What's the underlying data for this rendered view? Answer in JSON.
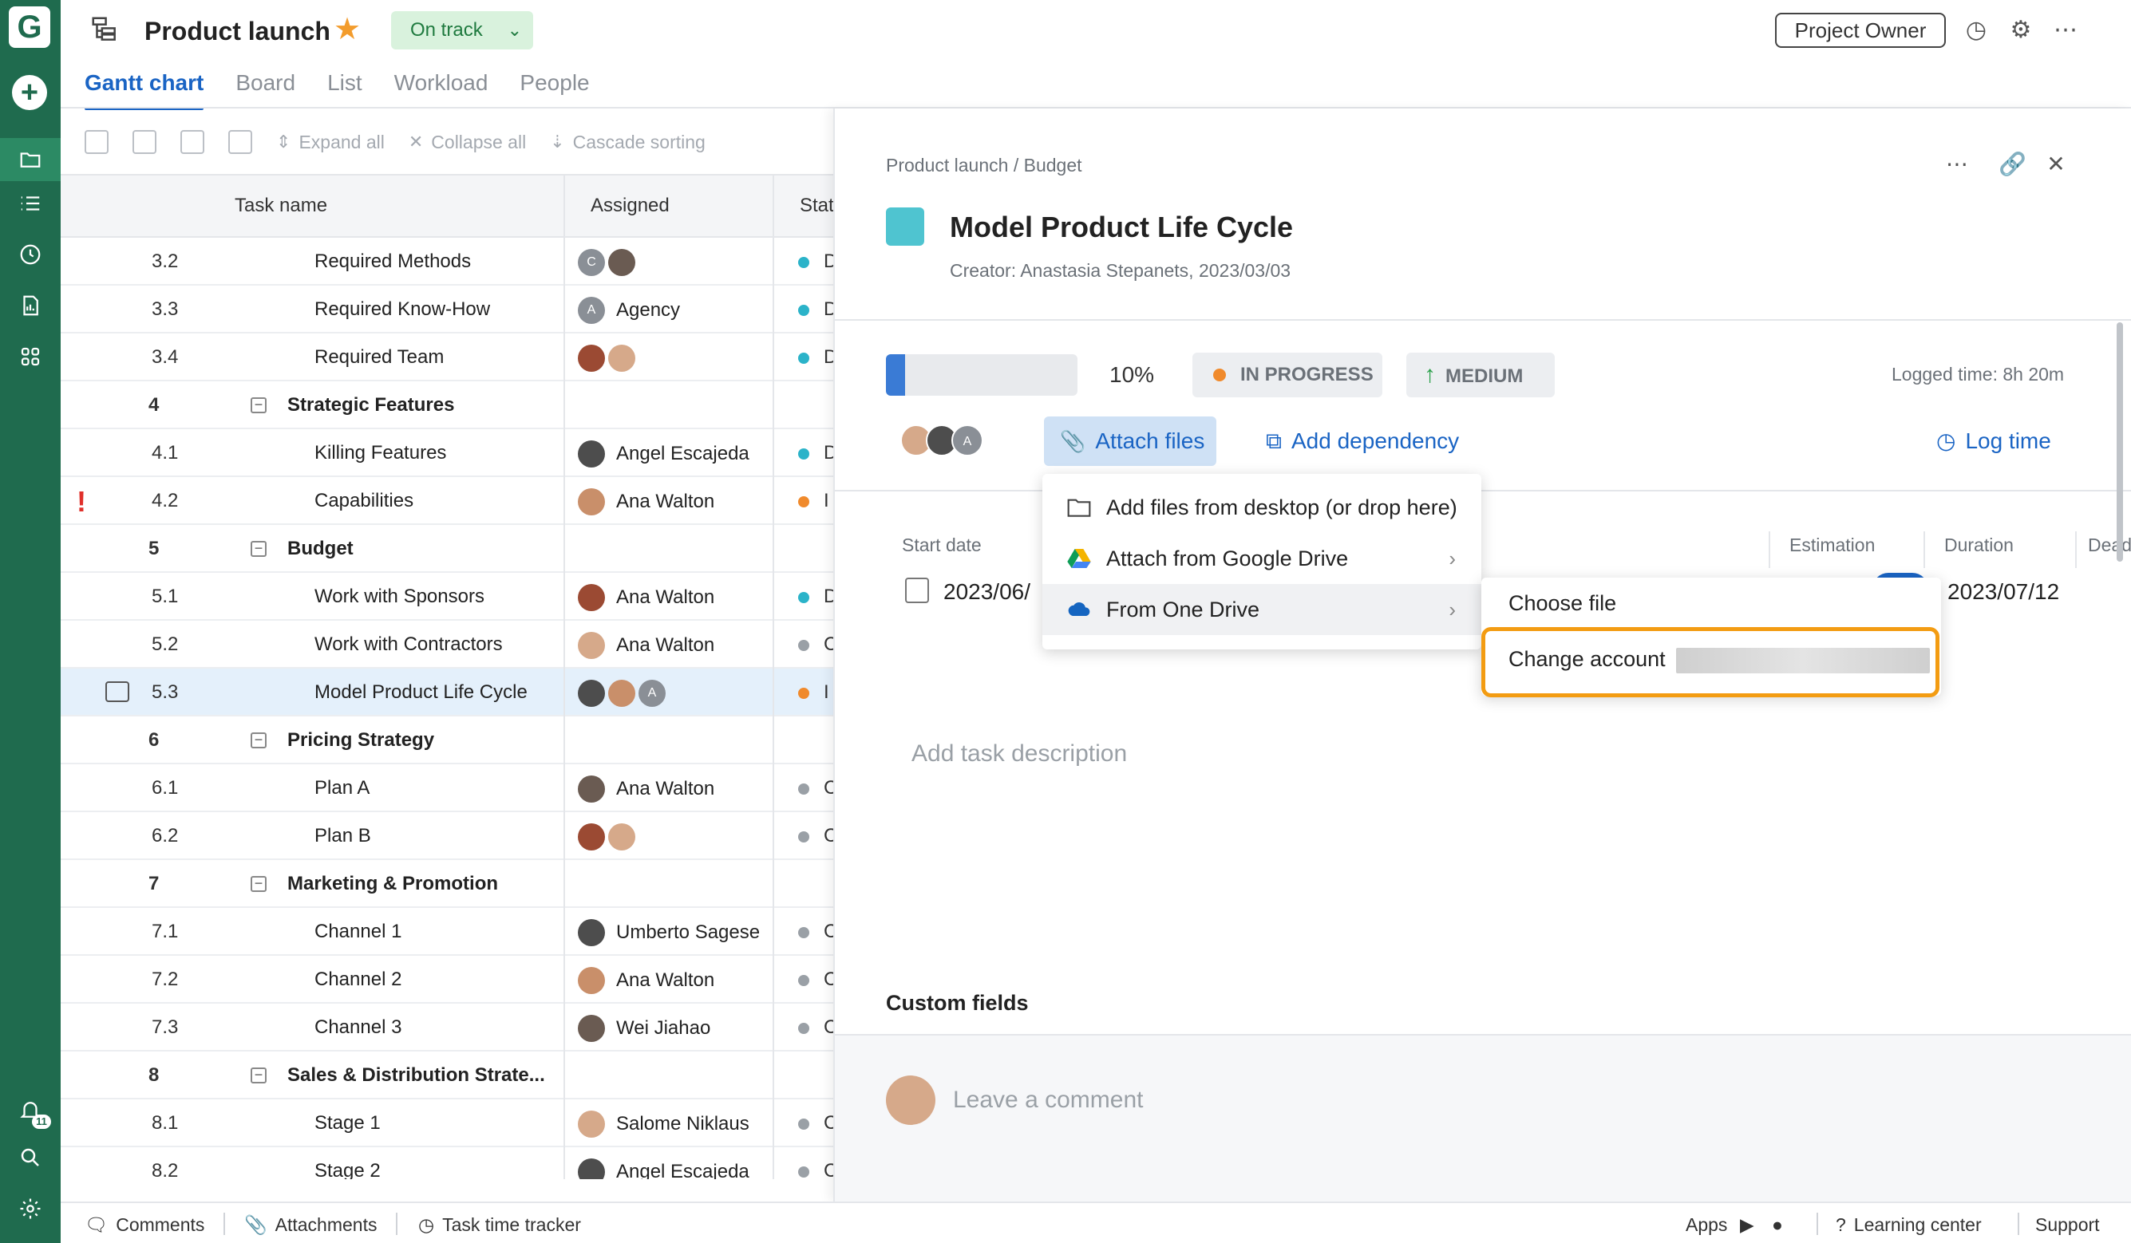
{
  "header": {
    "project_title": "Product launch",
    "status": "On track",
    "role_button": "Project Owner",
    "tabs": [
      "Gantt chart",
      "Board",
      "List",
      "Workload",
      "People"
    ],
    "active_tab": "Gantt chart"
  },
  "toolbar": {
    "expand_all": "Expand all",
    "collapse_all": "Collapse all",
    "cascade_sorting": "Cascade sorting"
  },
  "table": {
    "columns": {
      "task_name": "Task name",
      "assigned": "Assigned",
      "status": "Stat"
    },
    "rows": [
      {
        "num": "3.2",
        "name": "Required Methods",
        "group": false,
        "avatars": [
          "C",
          ""
        ],
        "assignee": "",
        "status_color": "#2bb3c9",
        "status_letter": "D"
      },
      {
        "num": "3.3",
        "name": "Required Know-How",
        "group": false,
        "avatars": [
          "A"
        ],
        "assignee": "Agency",
        "status_color": "#2bb3c9",
        "status_letter": "D"
      },
      {
        "num": "3.4",
        "name": "Required Team",
        "group": false,
        "avatars": [
          "",
          ""
        ],
        "assignee": "",
        "status_color": "#2bb3c9",
        "status_letter": "D"
      },
      {
        "num": "4",
        "name": "Strategic Features",
        "group": true
      },
      {
        "num": "4.1",
        "name": "Killing Features",
        "group": false,
        "avatars": [
          ""
        ],
        "assignee": "Angel Escajeda",
        "status_color": "#2bb3c9",
        "status_letter": "D"
      },
      {
        "num": "4.2",
        "name": "Capabilities",
        "group": false,
        "avatars": [
          ""
        ],
        "assignee": "Ana Walton",
        "status_color": "#f08a2c",
        "status_letter": "I",
        "flag": "!"
      },
      {
        "num": "5",
        "name": "Budget",
        "group": true
      },
      {
        "num": "5.1",
        "name": "Work with Sponsors",
        "group": false,
        "avatars": [
          ""
        ],
        "assignee": "Ana Walton",
        "status_color": "#2bb3c9",
        "status_letter": "D"
      },
      {
        "num": "5.2",
        "name": "Work with Contractors",
        "group": false,
        "avatars": [
          ""
        ],
        "assignee": "Ana Walton",
        "status_color": "#9aa0a6",
        "status_letter": "C"
      },
      {
        "num": "5.3",
        "name": "Model Product Life Cycle",
        "group": false,
        "avatars": [
          "",
          "",
          "A"
        ],
        "assignee": "",
        "status_color": "#f08a2c",
        "status_letter": "I",
        "selected": true
      },
      {
        "num": "6",
        "name": "Pricing Strategy",
        "group": true
      },
      {
        "num": "6.1",
        "name": "Plan A",
        "group": false,
        "avatars": [
          ""
        ],
        "assignee": "Ana Walton",
        "status_color": "#9aa0a6",
        "status_letter": "C"
      },
      {
        "num": "6.2",
        "name": "Plan B",
        "group": false,
        "avatars": [
          "",
          ""
        ],
        "assignee": "",
        "status_color": "#9aa0a6",
        "status_letter": "C"
      },
      {
        "num": "7",
        "name": "Marketing & Promotion",
        "group": true
      },
      {
        "num": "7.1",
        "name": "Channel 1",
        "group": false,
        "avatars": [
          ""
        ],
        "assignee": "Umberto Sagese",
        "status_color": "#9aa0a6",
        "status_letter": "C"
      },
      {
        "num": "7.2",
        "name": "Channel 2",
        "group": false,
        "avatars": [
          ""
        ],
        "assignee": "Ana Walton",
        "status_color": "#9aa0a6",
        "status_letter": "C"
      },
      {
        "num": "7.3",
        "name": "Channel 3",
        "group": false,
        "avatars": [
          ""
        ],
        "assignee": "Wei Jiahao",
        "status_color": "#9aa0a6",
        "status_letter": "C"
      },
      {
        "num": "8",
        "name": "Sales & Distribution Strate...",
        "group": true
      },
      {
        "num": "8.1",
        "name": "Stage 1",
        "group": false,
        "avatars": [
          ""
        ],
        "assignee": "Salome Niklaus",
        "status_color": "#9aa0a6",
        "status_letter": "C"
      },
      {
        "num": "8.2",
        "name": "Stage 2",
        "group": false,
        "avatars": [
          ""
        ],
        "assignee": "Angel Escajeda",
        "status_color": "#9aa0a6",
        "status_letter": "C"
      }
    ]
  },
  "panel": {
    "breadcrumb": "Product launch / Budget",
    "task_title": "Model Product Life Cycle",
    "creator": "Creator: Anastasia Stepanets, 2023/03/03",
    "progress_pct": "10%",
    "progress_value": 0.1,
    "status": "IN PROGRESS",
    "priority": "MEDIUM",
    "logged_time": "Logged time: 8h 20m",
    "attach_files": "Attach files",
    "add_dependency": "Add dependency",
    "log_time": "Log time",
    "labels": {
      "start_date": "Start date",
      "estimation": "Estimation",
      "duration": "Duration",
      "deadline": "Deadline"
    },
    "start_date_value": "2023/06/",
    "deadline_value": "2023/07/12",
    "description_placeholder": "Add task description",
    "custom_fields": "Custom fields",
    "comment_placeholder": "Leave a comment"
  },
  "attach_menu": {
    "items": [
      {
        "label": "Add files from desktop (or drop here)"
      },
      {
        "label": "Attach from Google Drive"
      },
      {
        "label": "From One Drive"
      }
    ]
  },
  "onedrive_submenu": {
    "items": [
      {
        "label": "Choose file"
      },
      {
        "label": "Change account"
      }
    ]
  },
  "bottombar": {
    "comments": "Comments",
    "attachments": "Attachments",
    "task_time_tracker": "Task time tracker",
    "apps": "Apps",
    "learning_center": "Learning center",
    "support": "Support"
  },
  "notifications_count": "11",
  "colors": {
    "sidebar": "#1f6b4e",
    "accent": "#1a64c4",
    "task_color": "#4fc4d0",
    "highlight": "#f39c12"
  }
}
